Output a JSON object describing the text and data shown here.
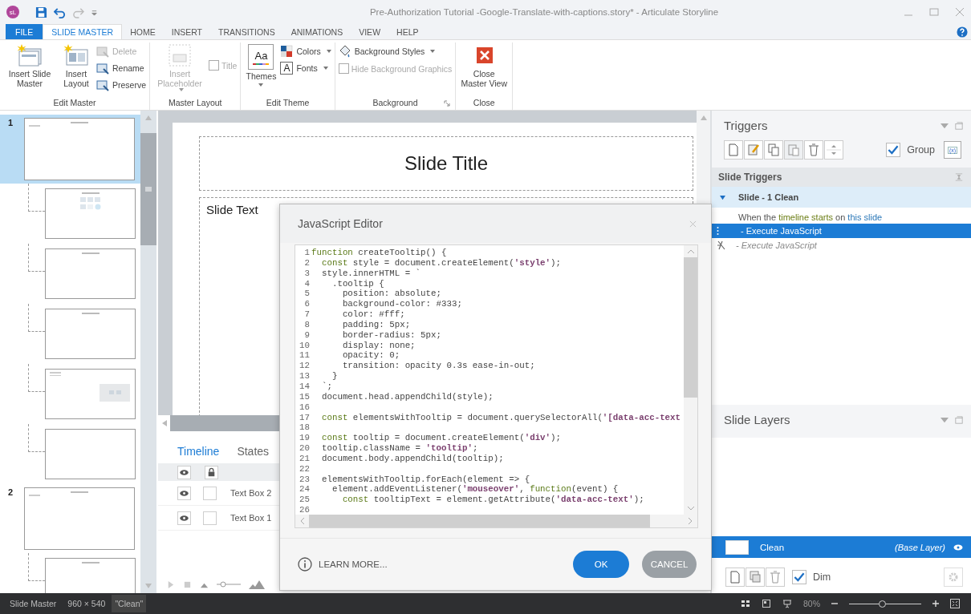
{
  "app_badge": "sL",
  "window": {
    "title": "Pre-Authorization Tutorial -Google-Translate-with-captions.story* -  Articulate Storyline"
  },
  "tabs": [
    {
      "label": "FILE",
      "kind": "file",
      "selected": false
    },
    {
      "label": "SLIDE MASTER",
      "kind": "tab",
      "selected": true
    },
    {
      "label": "HOME",
      "kind": "tab",
      "selected": false
    },
    {
      "label": "INSERT",
      "kind": "tab",
      "selected": false
    },
    {
      "label": "TRANSITIONS",
      "kind": "tab",
      "selected": false
    },
    {
      "label": "ANIMATIONS",
      "kind": "tab",
      "selected": false
    },
    {
      "label": "VIEW",
      "kind": "tab",
      "selected": false
    },
    {
      "label": "HELP",
      "kind": "tab",
      "selected": false
    }
  ],
  "ribbon": {
    "groups": [
      {
        "label": "Edit Master",
        "items": [
          {
            "label": "Insert Slide Master",
            "disabled": false
          },
          {
            "label": "Insert Layout",
            "disabled": false
          },
          {
            "label": "Delete",
            "disabled": true
          },
          {
            "label": "Rename",
            "disabled": false
          },
          {
            "label": "Preserve",
            "disabled": false
          }
        ]
      },
      {
        "label": "Master Layout",
        "items": [
          {
            "label": "Insert Placeholder",
            "disabled": true
          },
          {
            "label": "Title",
            "disabled": true,
            "checked": false
          }
        ]
      },
      {
        "label": "Edit Theme",
        "items": [
          {
            "label": "Themes",
            "preview": "Aa",
            "disabled": false
          },
          {
            "label": "Colors",
            "disabled": false
          },
          {
            "label": "Fonts",
            "glyph": "A",
            "disabled": false
          }
        ]
      },
      {
        "label": "Background",
        "items": [
          {
            "label": "Background Styles",
            "disabled": false
          },
          {
            "label": "Hide Background Graphics",
            "disabled": true,
            "checked": false
          }
        ]
      },
      {
        "label": "Close",
        "items": [
          {
            "label": "Close Master View",
            "disabled": false
          }
        ]
      }
    ]
  },
  "thumbnails": [
    {
      "kind": "master",
      "number": "1",
      "selected": true
    },
    {
      "kind": "icons",
      "selected": false
    },
    {
      "kind": "layout",
      "selected": false
    },
    {
      "kind": "layout",
      "selected": false
    },
    {
      "kind": "media",
      "selected": false
    },
    {
      "kind": "layout",
      "selected": false
    },
    {
      "kind": "master",
      "number": "2",
      "selected": false
    },
    {
      "kind": "layout",
      "selected": false
    }
  ],
  "slide": {
    "title": "Slide Title",
    "body": "Slide Text"
  },
  "timeline": {
    "tabs": [
      {
        "label": "Timeline",
        "selected": true
      },
      {
        "label": "States",
        "selected": false
      }
    ],
    "rows": [
      {
        "name": "Text Box 2",
        "visible": true,
        "locked": false
      },
      {
        "name": "Text Box 1",
        "visible": true,
        "locked": false
      }
    ]
  },
  "dialog": {
    "title": "JavaScript Editor",
    "link": "LEARN MORE...",
    "buttons": [
      {
        "label": "OK",
        "kind": "primary"
      },
      {
        "label": "CANCEL",
        "kind": "secondary"
      }
    ],
    "code": [
      {
        "n": "1",
        "code": "function createTooltip() {"
      },
      {
        "n": "2",
        "code": "  const style = document.createElement('style');"
      },
      {
        "n": "3",
        "code": "  style.innerHTML = `"
      },
      {
        "n": "4",
        "code": "    .tooltip {"
      },
      {
        "n": "5",
        "code": "      position: absolute;"
      },
      {
        "n": "6",
        "code": "      background-color: #333;"
      },
      {
        "n": "7",
        "code": "      color: #fff;"
      },
      {
        "n": "8",
        "code": "      padding: 5px;"
      },
      {
        "n": "9",
        "code": "      border-radius: 5px;"
      },
      {
        "n": "10",
        "code": "      display: none;"
      },
      {
        "n": "11",
        "code": "      opacity: 0;"
      },
      {
        "n": "12",
        "code": "      transition: opacity 0.3s ease-in-out;"
      },
      {
        "n": "13",
        "code": "    }"
      },
      {
        "n": "14",
        "code": "  `;"
      },
      {
        "n": "15",
        "code": "  document.head.appendChild(style);"
      },
      {
        "n": "16"
      },
      {
        "n": "17",
        "code": "  const elementsWithTooltip = document.querySelectorAll('[data-acc-text"
      },
      {
        "n": "18"
      },
      {
        "n": "19",
        "code": "  const tooltip = document.createElement('div');"
      },
      {
        "n": "20",
        "code": "  tooltip.className = 'tooltip';"
      },
      {
        "n": "21",
        "code": "  document.body.appendChild(tooltip);"
      },
      {
        "n": "22"
      },
      {
        "n": "23",
        "code": "  elementsWithTooltip.forEach(element => {"
      },
      {
        "n": "24",
        "code": "    element.addEventListener('mouseover', function(event) {"
      },
      {
        "n": "25",
        "code": "      const tooltipText = element.getAttribute('data-acc-text');"
      },
      {
        "n": "26"
      }
    ]
  },
  "triggers": {
    "title": "Triggers",
    "group_label": "Group",
    "group_checked": true,
    "variables_glyph": "(x)",
    "section": "Slide Triggers",
    "owner": {
      "label": "Slide - 1 Clean",
      "expanded": true
    },
    "condition": [
      {
        "text": "When the ",
        "kind": "plain"
      },
      {
        "text": "timeline starts",
        "kind": "event"
      },
      {
        "text": " on ",
        "kind": "plain"
      },
      {
        "text": "this slide",
        "kind": "object"
      }
    ],
    "actions": [
      {
        "text": "- Execute JavaScript",
        "selected": true,
        "disabled": false
      },
      {
        "text": "- Execute JavaScript",
        "selected": false,
        "disabled": true
      }
    ]
  },
  "layers": {
    "title": "Slide Layers",
    "items": [
      {
        "name": "Clean",
        "note": "(Base Layer)",
        "selected": true
      }
    ],
    "dim_label": "Dim",
    "dim_checked": true
  },
  "status_bar": {
    "mode": "Slide Master",
    "size": "960 × 540",
    "layer": "\"Clean\"",
    "zoom": "80%",
    "zoom_slider": {
      "level": 0.45
    }
  }
}
